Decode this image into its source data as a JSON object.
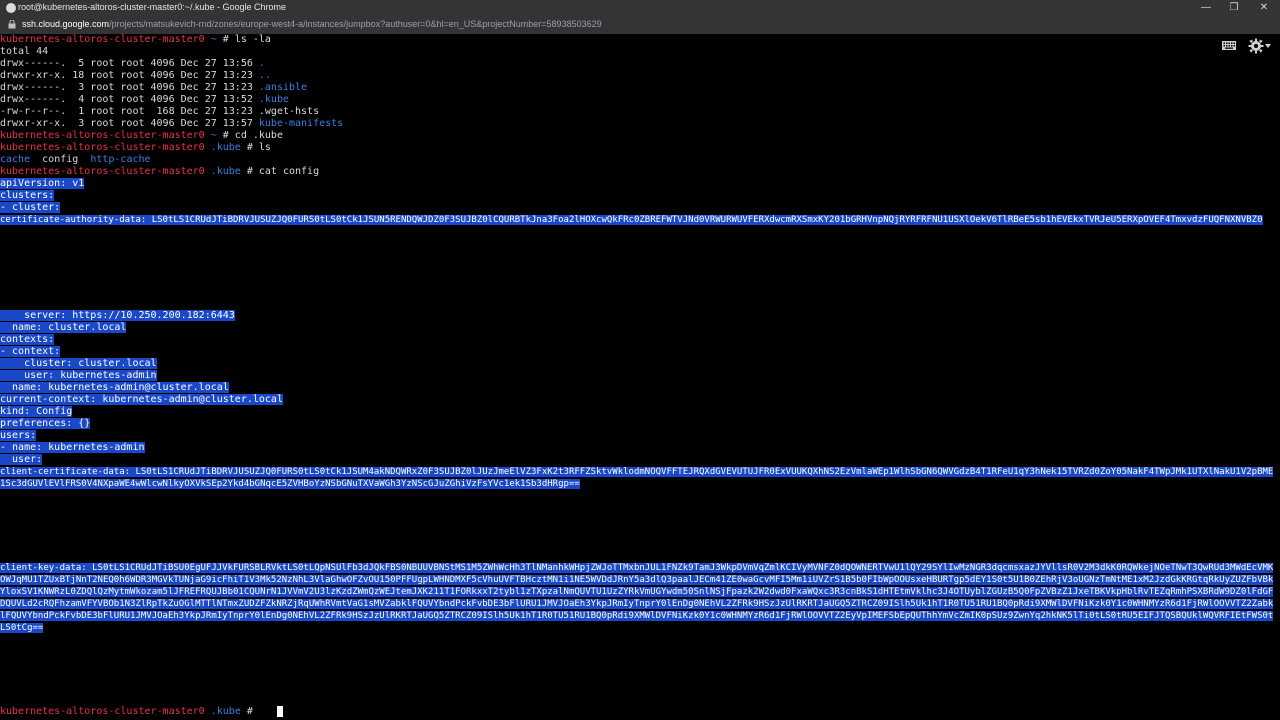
{
  "window": {
    "title": "root@kubernetes-altoros-cluster-master0:~/.kube - Google Chrome",
    "controls": [
      "minimize",
      "restore",
      "close"
    ]
  },
  "address_bar": {
    "host": "ssh.cloud.google.com",
    "path": "/projects/matsukevich-rnd/zones/europe-west4-a/instances/jumpbox?authuser=0&hl=en_US&projectNumber=58938503629"
  },
  "terminal": {
    "tools": [
      "keyboard-icon",
      "gear-icon"
    ],
    "lines": [
      {
        "prompt": "kubernetes-altoros-cluster-master0",
        "cwd": " ~",
        "cmd": " # ls -la"
      },
      {
        "text": "total 44"
      },
      {
        "perms": "drwx------.  5 root root 4096 Dec 27 13:56 ",
        "name": "."
      },
      {
        "perms": "drwxr-xr-x. 18 root root 4096 Dec 27 13:23 ",
        "name": ".."
      },
      {
        "perms": "drwx------.  3 root root 4096 Dec 27 13:23 ",
        "name": ".ansible"
      },
      {
        "perms": "drwx------.  4 root root 4096 Dec 27 13:52 ",
        "name": ".kube"
      },
      {
        "perms": "-rw-r--r--.  1 root root  168 Dec 27 13:23 ",
        "name": ".wget-hsts",
        "plainname": true
      },
      {
        "perms": "drwxr-xr-x.  3 root root 4096 Dec 27 13:57 ",
        "name": "kube-manifests"
      },
      {
        "prompt": "kubernetes-altoros-cluster-master0",
        "cwd": " ~",
        "cmd": " # cd .kube"
      },
      {
        "prompt": "kubernetes-altoros-cluster-master0",
        "cwd": " .kube",
        "cmd": " # ls"
      },
      {
        "ls": [
          "cache",
          "config",
          "http-cache"
        ]
      },
      {
        "prompt": "kubernetes-altoros-cluster-master0",
        "cwd": " .kube",
        "cmd": " # cat config"
      }
    ],
    "config": [
      "apiVersion: v1",
      "clusters:",
      "- cluster:",
      "    certificate-authority-data: LS0tLS1CRUdJTiBDRVJUSUZJQ0FURS0tLS0tCk1JSUN5RENDQWJDZ0F3SUJBZ0lCQURBTkJna3Foa2lHOXcwQkFRc0ZBREFWTVJNd0VRWURWUVFERXdwcmRXSmxKY201bGRHVnpNQjRYRFRFNU1USXlOekV6TlRBeE5sb1hEVEkxTVRJeU5ERXpOVEF4TmxvdzFUQFNXNVBZ0",
      "    server: https://10.250.200.182:6443",
      "  name: cluster.local",
      "contexts:",
      "- context:",
      "    cluster: cluster.local",
      "    user: kubernetes-admin",
      "  name: kubernetes-admin@cluster.local",
      "current-context: kubernetes-admin@cluster.local",
      "kind: Config",
      "preferences: {}",
      "users:",
      "- name: kubernetes-admin",
      "  user:",
      "    client-certificate-data: LS0tLS1CRUdJTiBDRVJUSUZJQ0FURS0tLS0tCk1JSUM4akNDQWRxZ0F3SUJBZ0lJUzJmeElVZ3FxK2t3RFFZSktvWklodmNOQVFFTEJRQXdGVEVUTUJFR0ExVUUKQXhNS2EzVmlaWEp1WlhSbGN6QWVGdzB4T1RFeU1qY3hNek15TVRZd0ZoY05NakF4TWpJMk1UTXlNakU1V2pBME1Sc3dGUVlEVlFRS0V4NXpaWE4wWlcwNlkyOXVkSEp2Ykd4bGNqcE5ZVHBoYzNSbGNuTXVaWGh3YzNScGJuZGhiVzFsYVc1ek1Sb3dHRgp==",
      "    client-key-data: LS0tLS1CRUdJTiBSU0EgUFJJVkFURSBLRVktLS0tLQpNSUlFb3dJQkFBS0NBUUVBNStMS1M5ZWhWcHh3TlNManhkWHpjZWJoTTMxbnJUL1FNZk9TamJ3WkpDVmVqZmlKCIVyMVNFZ0dQOWNERTVwU1lQY29SYlIwMzNGR3dqcmsxazJYVllsR0V2M3dkK0RQWkejNOeTNwT3QwRUd3MWdEcVMKOWJqMU1TZUxBTjNnT2NEQ0h6WDR3MGVkTUNjaG9icFhiT1V3Mk52NzNhL3VlaGhwOFZvOU150PFFUgpLWHNDMXF5cVhuUVFTBHcztMN1i1NE5WVDdJRnY5a3dlQ3paalJECm41ZE0waGcvMFI5Mm1iUVZrS1B5b0FIbWpOOUsxeHBURTgp5dEY1S0t5U1B0ZEhRjV3oUGNzTmNtME1xM2JzdGkKRGtqRkUyZUZFbVBkYloxSV1KNWRzL0ZDQlQzMytmWkozam5lJFREFRQUJBb01CQUNrN1JVVmV2U3lzKzdZWmQzWEJtemJXK211T1FORkxxT2tybl1zTXpzalNmQUVTU1UzZYRkVmUGYwdm50SnlNSjFpazk2W2dwd0FxaWQxc3R3cnBkS1dHTEtmVklhc3J4OTUyblZGUzB5Q0FpZVBzZ1JxeTBKVkpHblRvTEZqRmhPSXBRdW9DZ0lFdGFDQUVLd2cRQFhzamVFYVBOb1N3ZlRpTkZuOGlMTTlNTmxZUDZFZkNRZjRqUWhRVmtVaG1sMVZabklFQUVYbndPckFvbDE3bFlURU1JMVJOaEh3YkpJRmIyTnprY0lEnDg0NEhVL2ZFRk9HSzJzUlRKRTJaUGQ5ZTRCZ09ISlh5Uk1hT1R0TU51RU1BQ0pRdi9XMWlDVFNiKzk0Y1c0WHNMYzR6d1FjRWlOOVVTZ2ZabklFQUVYbndPckFvbDE3bFlURU1JMVJOaEh3YkpJRmIyTnprY0lEnDg0NEhVL2ZFRk9HSzJzUlRKRTJaUGQ5ZTRCZ09ISlh5Uk1hT1R0TU51RU1BQ0pRdi9XMWlDVFNiKzk0Y1c0WHNMYzR6d1FjRWlOOVVTZ2EyVpIMEFSbEpQUThhYmVcZmIK0pSUz9ZwnYq2hkNK5lTi0tLS0tRU5EIFJTQSBQUklWQVRFIEtFWS0tLS0tCg=="
    ],
    "final_prompt": {
      "prompt": "kubernetes-altoros-cluster-master0",
      "cwd": " .kube",
      "cmd": " # "
    }
  }
}
